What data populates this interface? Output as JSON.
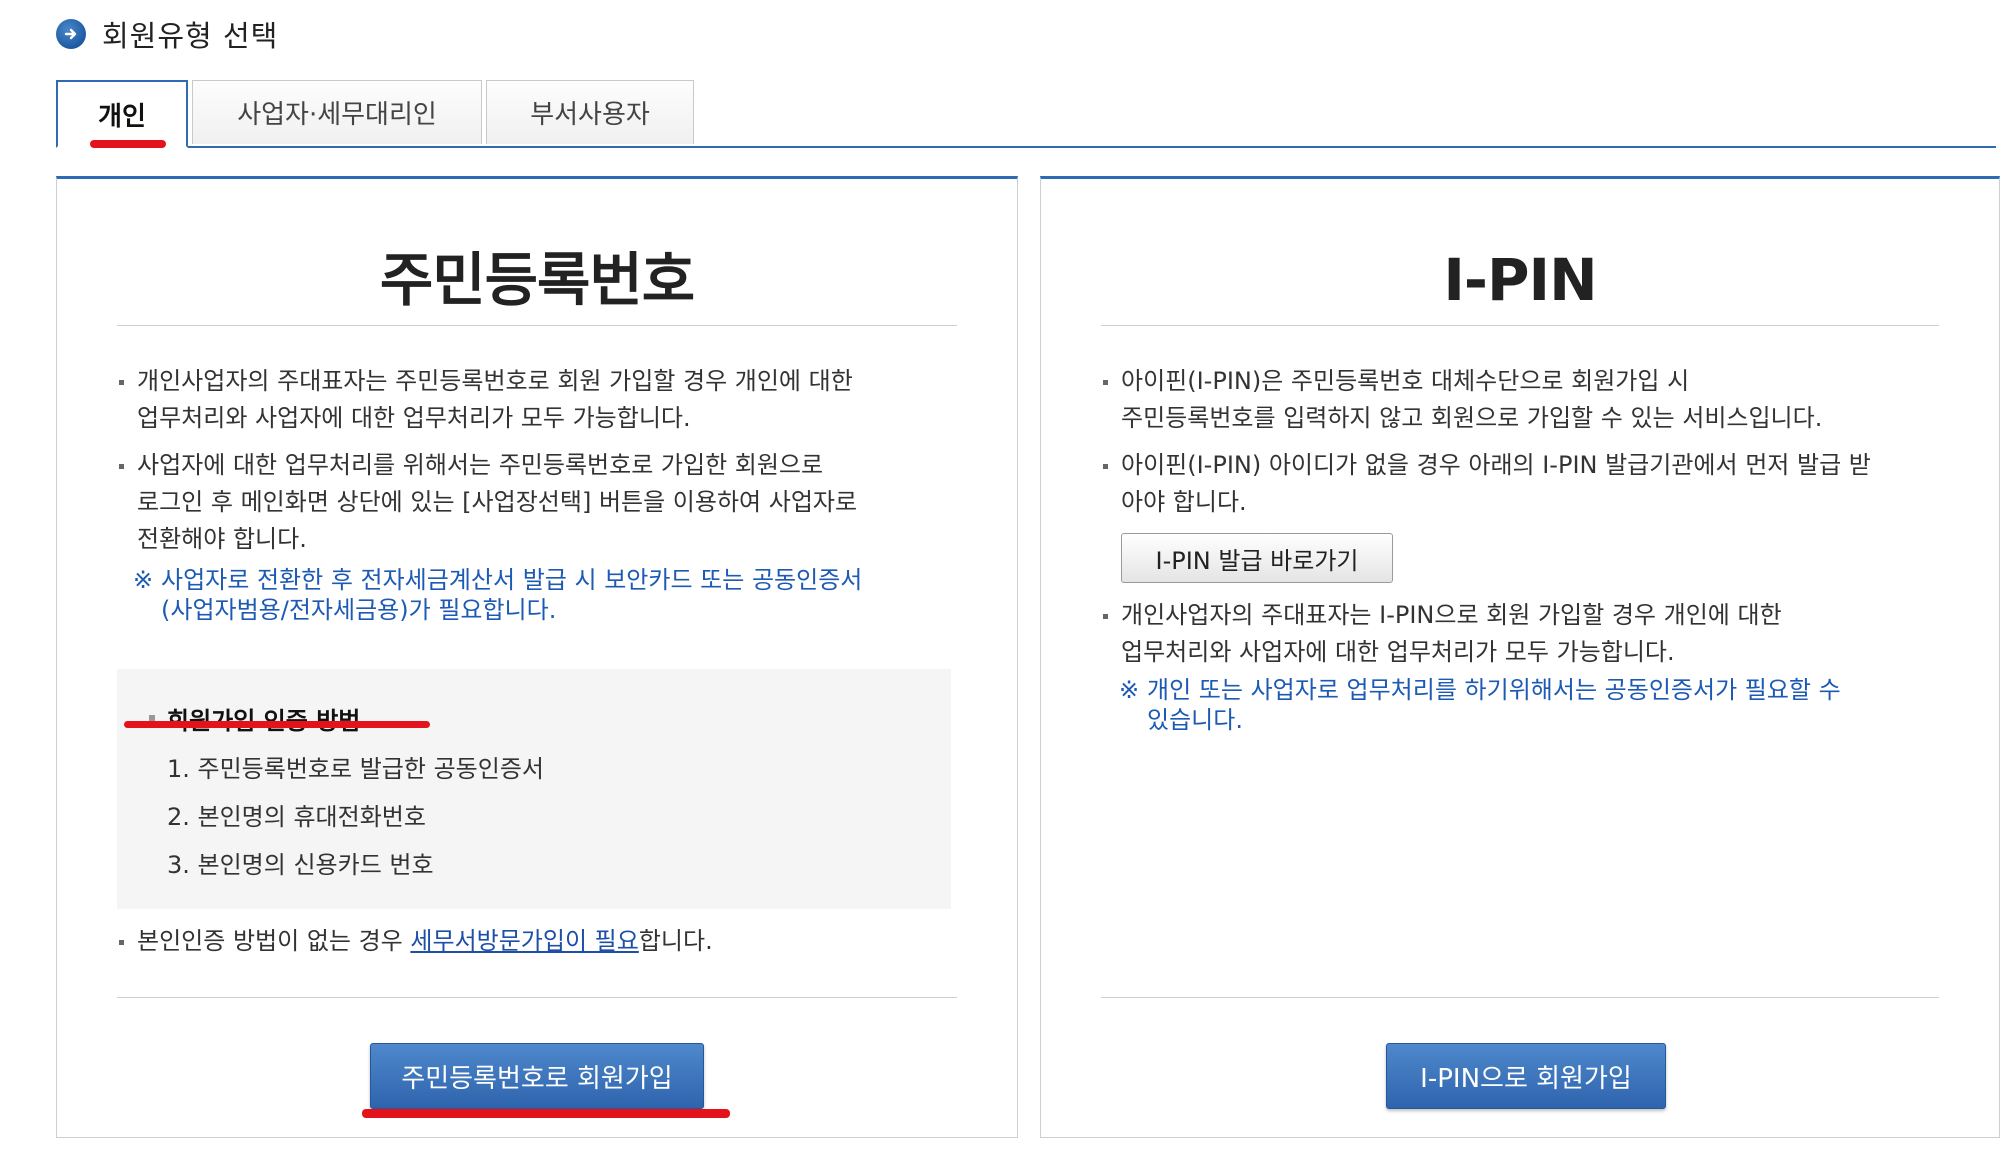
{
  "section": {
    "title": "회원유형 선택"
  },
  "tabs": [
    {
      "label": "개인"
    },
    {
      "label": "사업자·세무대리인"
    },
    {
      "label": "부서사용자"
    }
  ],
  "colors": {
    "accent": "#2d6cb5",
    "note": "#1d5ab4",
    "highlight": "#e4121a"
  },
  "resident_panel": {
    "heading": "주민등록번호",
    "bullet1_line1": "개인사업자의 주대표자는 주민등록번호로 회원 가입할 경우 개인에 대한",
    "bullet1_line2": "업무처리와 사업자에 대한 업무처리가 모두 가능합니다.",
    "bullet2_line1": "사업자에 대한 업무처리를 위해서는 주민등록번호로 가입한 회원으로",
    "bullet2_line2": "로그인 후 메인화면 상단에 있는 [사업장선택] 버튼을 이용하여 사업자로",
    "bullet2_line3": "전환해야 합니다.",
    "note_mark": "※",
    "note_line1": "사업자로 전환한 후 전자세금계산서 발급 시 보안카드 또는 공동인증서",
    "note_line2": "(사업자범용/전자세금용)가 필요합니다.",
    "method_title": "회원가입 인증 방법",
    "methods": [
      "1. 주민등록번호로 발급한 공동인증서",
      "2. 본인명의 휴대전화번호",
      "3. 본인명의 신용카드 번호"
    ],
    "no_auth_prefix": "본인인증 방법이 없는 경우 ",
    "no_auth_link": "세무서방문가입이 필요",
    "no_auth_suffix": "합니다.",
    "join_button": "주민등록번호로 회원가입"
  },
  "ipin_panel": {
    "heading": "I-PIN",
    "bullet1_line1": "아이핀(I-PIN)은 주민등록번호 대체수단으로 회원가입 시",
    "bullet1_line2": "주민등록번호를 입력하지 않고 회원으로 가입할 수 있는 서비스입니다.",
    "bullet2_line1": "아이핀(I-PIN) 아이디가 없을 경우 아래의 I-PIN 발급기관에서 먼저 발급 받",
    "bullet2_line2": "아야 합니다.",
    "issue_button": "I-PIN 발급 바로가기",
    "bullet3_line1": "개인사업자의 주대표자는 I-PIN으로 회원 가입할 경우 개인에 대한",
    "bullet3_line2": "업무처리와 사업자에 대한 업무처리가 모두 가능합니다.",
    "note_mark": "※",
    "note_line1": "개인 또는 사업자로 업무처리를 하기위해서는 공동인증서가 필요할 수",
    "note_line2": "있습니다.",
    "join_button": "I-PIN으로 회원가입"
  }
}
